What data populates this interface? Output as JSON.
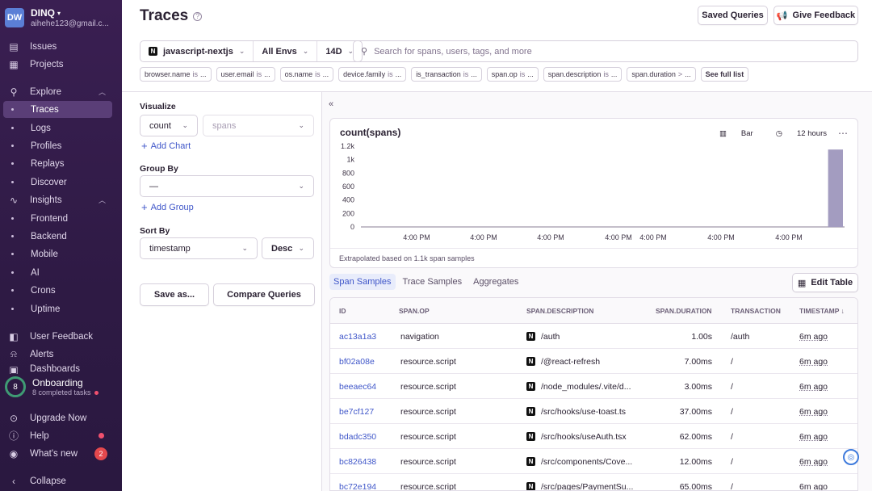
{
  "org": {
    "initials": "DW",
    "name": "DINQ",
    "email": "aihehe123@gmail.c..."
  },
  "nav": {
    "issues": "Issues",
    "projects": "Projects",
    "explore": "Explore",
    "traces": "Traces",
    "logs": "Logs",
    "profiles": "Profiles",
    "replays": "Replays",
    "discover": "Discover",
    "insights": "Insights",
    "frontend": "Frontend",
    "backend": "Backend",
    "mobile": "Mobile",
    "ai": "AI",
    "crons": "Crons",
    "uptime": "Uptime",
    "user_feedback": "User Feedback",
    "alerts": "Alerts",
    "dashboards": "Dashboards"
  },
  "onboarding": {
    "progress": "8",
    "title": "Onboarding",
    "subtitle": "8 completed tasks"
  },
  "bottom_nav": {
    "upgrade": "Upgrade Now",
    "help": "Help",
    "whats_new": "What's new",
    "whats_new_count": "2",
    "collapse": "Collapse"
  },
  "header": {
    "title": "Traces",
    "saved_queries": "Saved Queries",
    "give_feedback": "Give Feedback"
  },
  "filters": {
    "project": "javascript-nextjs",
    "env": "All Envs",
    "period": "14D",
    "search_placeholder": "Search for spans, users, tags, and more"
  },
  "chips": [
    {
      "key": "browser.name",
      "op": "is",
      "val": "..."
    },
    {
      "key": "user.email",
      "op": "is",
      "val": "..."
    },
    {
      "key": "os.name",
      "op": "is",
      "val": "..."
    },
    {
      "key": "device.family",
      "op": "is",
      "val": "..."
    },
    {
      "key": "is_transaction",
      "op": "is",
      "val": "..."
    },
    {
      "key": "span.op",
      "op": "is",
      "val": "..."
    },
    {
      "key": "span.description",
      "op": "is",
      "val": "..."
    },
    {
      "key": "span.duration",
      "op": ">",
      "val": "..."
    }
  ],
  "see_full_list": "See full list",
  "left_panel": {
    "visualize_label": "Visualize",
    "aggregate": "count",
    "field": "spans",
    "add_chart": "Add Chart",
    "group_by_label": "Group By",
    "group_by_value": "—",
    "add_group": "Add Group",
    "sort_by_label": "Sort By",
    "sort_field": "timestamp",
    "sort_dir": "Desc",
    "save_as": "Save as...",
    "compare": "Compare Queries"
  },
  "chart_data": {
    "type": "bar",
    "title": "count(spans)",
    "chart_type_label": "Bar",
    "interval_label": "12 hours",
    "y_ticks": [
      "1.2k",
      "1k",
      "800",
      "600",
      "400",
      "200",
      "0"
    ],
    "x_ticks": [
      "4:00 PM",
      "4:00 PM",
      "4:00 PM",
      "4:00 PM",
      "4:00 PM",
      "4:00 PM",
      "4:00 PM",
      "4:00 PM"
    ],
    "ylim": [
      0,
      1200
    ],
    "values": [
      0,
      0,
      0,
      0,
      0,
      0,
      0,
      0,
      0,
      0,
      0,
      0,
      0,
      0,
      0,
      0,
      0,
      0,
      0,
      0,
      0,
      0,
      0,
      0,
      0,
      0,
      0,
      1150
    ],
    "bar_color": "#a39cc0",
    "footer": "Extrapolated based on 1.1k span samples"
  },
  "tabs": [
    "Span Samples",
    "Trace Samples",
    "Aggregates"
  ],
  "edit_table": "Edit Table",
  "table": {
    "columns": [
      "ID",
      "SPAN.OP",
      "SPAN.DESCRIPTION",
      "SPAN.DURATION",
      "TRANSACTION",
      "TIMESTAMP ↓"
    ],
    "rows": [
      {
        "id": "ac13a1a3",
        "op": "navigation",
        "desc": "/auth",
        "duration": "1.00s",
        "transaction": "/auth",
        "timestamp": "6m ago"
      },
      {
        "id": "bf02a08e",
        "op": "resource.script",
        "desc": "/@react-refresh",
        "duration": "7.00ms",
        "transaction": "/",
        "timestamp": "6m ago"
      },
      {
        "id": "beeaec64",
        "op": "resource.script",
        "desc": "/node_modules/.vite/d...",
        "duration": "3.00ms",
        "transaction": "/",
        "timestamp": "6m ago"
      },
      {
        "id": "be7cf127",
        "op": "resource.script",
        "desc": "/src/hooks/use-toast.ts",
        "duration": "37.00ms",
        "transaction": "/",
        "timestamp": "6m ago"
      },
      {
        "id": "bdadc350",
        "op": "resource.script",
        "desc": "/src/hooks/useAuth.tsx",
        "duration": "62.00ms",
        "transaction": "/",
        "timestamp": "6m ago"
      },
      {
        "id": "bc826438",
        "op": "resource.script",
        "desc": "/src/components/Cove...",
        "duration": "12.00ms",
        "transaction": "/",
        "timestamp": "6m ago"
      },
      {
        "id": "bc72e194",
        "op": "resource.script",
        "desc": "/src/pages/PaymentSu...",
        "duration": "65.00ms",
        "transaction": "/",
        "timestamp": "6m ago"
      }
    ]
  }
}
